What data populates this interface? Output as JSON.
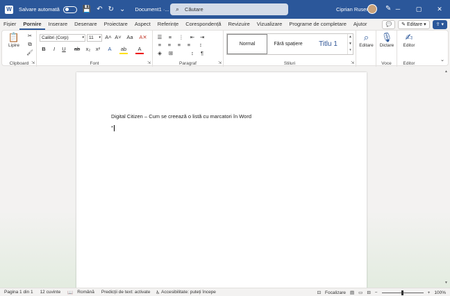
{
  "titlebar": {
    "logo": "W",
    "autosave_label": "Salvare automată",
    "save_icon": "💾",
    "undo_icon": "↶",
    "redo_icon": "↻",
    "more_icon": "⌄",
    "doc_name": "Document1 ·...",
    "search_placeholder": "Căutare",
    "user_name": "Ciprian Rusen",
    "pen_icon": "✎",
    "minimize": "─",
    "maximize": "▢",
    "close": "✕"
  },
  "tabs": [
    "Fișier",
    "Pornire",
    "Inserare",
    "Desenare",
    "Proiectare",
    "Aspect",
    "Referințe",
    "Corespondență",
    "Revizuire",
    "Vizualizare",
    "Programe de completare",
    "Ajutor"
  ],
  "active_tab_index": 1,
  "rightbuttons": {
    "comments_icon": "💬",
    "editing_label": "Editare",
    "share_icon": "⇪"
  },
  "ribbon": {
    "clipboard": {
      "label": "Clipboard",
      "paste_label": "Lipire",
      "paste_icon": "📋",
      "cut_icon": "✂",
      "copy_icon": "⧉",
      "painter_icon": "🖌"
    },
    "font": {
      "label": "Font",
      "font_name": "Calibri (Corp)",
      "font_size": "11",
      "grow": "A˄",
      "shrink": "A˅",
      "case": "Aa",
      "clear": "A✕",
      "bold": "B",
      "italic": "I",
      "underline": "U",
      "strike": "ab",
      "subscript": "x₂",
      "superscript": "x²",
      "effects": "A",
      "highlight": "ab",
      "color": "A"
    },
    "paragraph": {
      "label": "Paragraf",
      "bullets": "☰",
      "numbering": "≡",
      "multilevel": "⋮",
      "decrease": "⇤",
      "increase": "⇥",
      "sort": "↕",
      "pilcrow": "¶",
      "align_left": "≡",
      "align_center": "≡",
      "align_right": "≡",
      "justify": "≡",
      "spacing": "↕",
      "shading": "◈",
      "borders": "⊞"
    },
    "styles": {
      "label": "Stiluri",
      "items": [
        "Normal",
        "Fără spațiere",
        "Titlu 1"
      ]
    },
    "editing": {
      "label": "Editare",
      "icon": "⌕"
    },
    "voice": {
      "label": "Voce",
      "dictate_label": "Dictare",
      "icon": "🎙"
    },
    "editor": {
      "label": "Editor",
      "button_label": "Editor",
      "icon": "✍"
    },
    "collapse_icon": "⌄"
  },
  "document": {
    "line1": "Digital Citizen – Cum se creează o listă cu marcatori în Word",
    "line2": "*"
  },
  "statusbar": {
    "page": "Pagina 1 din 1",
    "words": "12 cuvinte",
    "language": "Română",
    "predictions": "Predicții de text: activate",
    "accessibility": "Accesibilitate: puteți începe",
    "focus": "Focalizare",
    "zoom_minus": "−",
    "zoom_plus": "+",
    "zoom": "100%"
  }
}
